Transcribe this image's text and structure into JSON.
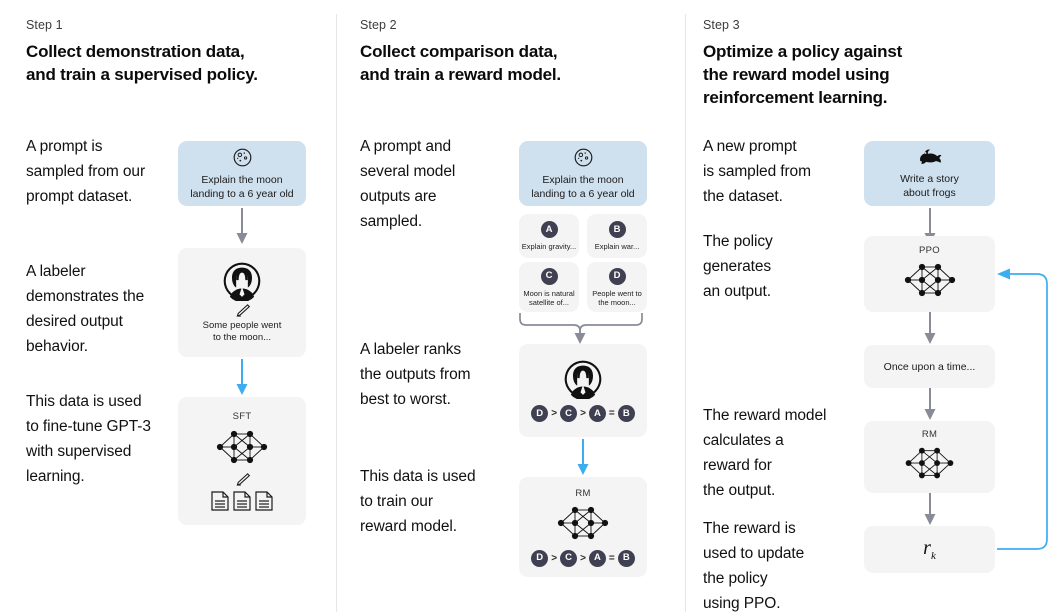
{
  "columns": [
    {
      "step_label": "Step 1",
      "title_lines": [
        "Collect demonstration data,",
        "and train a supervised policy."
      ],
      "paragraphs": [
        "A prompt is\nsampled from our\nprompt dataset.",
        "A labeler\ndemonstrates the\ndesired output\nbehavior.",
        "This data is used\nto fine-tune GPT-3\nwith supervised\nlearning."
      ],
      "cards": [
        {
          "kind": "prompt",
          "icon": "moon-icon",
          "text": "Explain the moon\nlanding to a 6 year old"
        },
        {
          "kind": "labeler",
          "icon": "labeler-avatar-icon",
          "pencil": "pencil-icon",
          "text": "Some people went\nto the moon..."
        },
        {
          "kind": "model",
          "title": "SFT",
          "icon": "neural-network-icon",
          "pencil": "pencil-icon",
          "docs": "documents-icon"
        }
      ]
    },
    {
      "step_label": "Step 2",
      "title_lines": [
        "Collect comparison data,",
        "and train a reward model."
      ],
      "paragraphs": [
        "A prompt and\nseveral model\noutputs are\nsampled.",
        "A labeler ranks\nthe outputs from\nbest to worst.",
        "This data is used\nto train our\nreward model."
      ],
      "cards": [
        {
          "kind": "prompt",
          "icon": "moon-icon",
          "text": "Explain the moon\nlanding to a 6 year old"
        },
        {
          "kind": "model",
          "title": "RM",
          "icon": "neural-network-icon"
        }
      ],
      "options": [
        {
          "letter": "A",
          "text": "Explain gravity..."
        },
        {
          "letter": "B",
          "text": "Explain war..."
        },
        {
          "letter": "C",
          "text": "Moon is natural\nsatellite of..."
        },
        {
          "letter": "D",
          "text": "People went to\nthe moon..."
        }
      ],
      "ranking": [
        "D",
        ">",
        "C",
        ">",
        "A",
        "=",
        "B"
      ]
    },
    {
      "step_label": "Step 3",
      "title_lines": [
        "Optimize a policy against",
        "the reward model using",
        "reinforcement learning."
      ],
      "paragraphs": [
        "A new prompt\nis sampled from\nthe dataset.",
        "The policy\ngenerates\nan output.",
        "The reward model\ncalculates a\nreward for\nthe output.",
        "The reward is\nused to update\nthe policy\nusing PPO."
      ],
      "cards": [
        {
          "kind": "prompt",
          "icon": "frog-icon",
          "text": "Write a story\nabout frogs"
        },
        {
          "kind": "model",
          "title": "PPO",
          "icon": "neural-network-icon"
        },
        {
          "kind": "output",
          "text": "Once upon a time..."
        },
        {
          "kind": "model",
          "title": "RM",
          "icon": "neural-network-icon"
        },
        {
          "kind": "reward",
          "symbol": "r",
          "subscript": "k"
        }
      ]
    }
  ],
  "colors": {
    "prompt_card": "#cfe0ef",
    "gray_card": "#f4f4f4",
    "arrow_gray": "#8a8b99",
    "arrow_blue": "#3cadf0",
    "badge": "#3f4152",
    "divider": "#e6e6e6"
  }
}
